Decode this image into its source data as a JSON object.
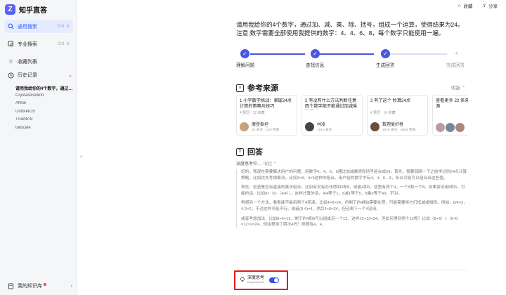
{
  "app": {
    "name": "知乎直答",
    "logo_glyph": "Z"
  },
  "sidebar": {
    "items": [
      {
        "label": "通用搜索",
        "shortcut_a": "Ctrl",
        "shortcut_b": "K",
        "icon": "search-icon"
      },
      {
        "label": "专业搜索",
        "shortcut_a": "Ctrl",
        "shortcut_b": "K",
        "icon": "expert-search-icon"
      },
      {
        "label": "收藏列表",
        "icon": "star-icon"
      }
    ],
    "history_label": "历史记录",
    "history": [
      "请用我给你的4个数字，通过加、减、乘、除、括号，组成一个运算，使得结果为24。",
      "CrystalDiskInfo",
      "Affine",
      "UmbrelOS",
      "TrueNAS",
      "tailscale"
    ],
    "knowledge_base": "我的知识库"
  },
  "top_actions": {
    "favorite": "收藏",
    "share": "分享"
  },
  "question": "请用我给你的4个数字，通过加、减、乘、除、括号，组成一个运算，使得结果为24。注意:数字需要全部使用我提供的数字：4、4、6、8，每个数字只能使用一遍。",
  "steps": [
    {
      "label": "理解问题",
      "done": true,
      "marker": "✓"
    },
    {
      "label": "查找信息",
      "done": true,
      "marker": "✓"
    },
    {
      "label": "生成回答",
      "done": true,
      "marker": "✓"
    },
    {
      "label": "完成回答",
      "done": false,
      "marker": "4"
    }
  ],
  "sources": {
    "title": "参考来源",
    "collapse": "收起",
    "cards": [
      {
        "index": "1",
        "title": "小学数学挑战：掌握24点计算的策略与技巧",
        "meta": "4 赞同 · 12 收藏",
        "author": "摩登泰坦",
        "stats": "24 关注 · 128 赞同"
      },
      {
        "index": "2",
        "title": "有没有什么方法判断任意四个数字能不能通过加减乘除得到24？",
        "meta": "",
        "author": "林凌",
        "stats": "1010 关注"
      },
      {
        "index": "3",
        "title": "有了这个 秒算24点",
        "meta": "4 赞同 · 14 收藏",
        "author": "数理爱好者",
        "stats": "1675 关注 · 3563 赞同"
      },
      {
        "index": "",
        "title": "查看更多 22 条来源",
        "meta": "",
        "author": "",
        "stats": ""
      }
    ]
  },
  "answer": {
    "title": "回答",
    "thinking_label": "深度思考中...",
    "thinking_collapse": "收起",
    "paragraphs": [
      "好的，我现在需要解决用户的问题，用数字4、4、6、8通过加减乘除和括号组合成24。首先，我要回顾一下之前学过的24点计算策略，比如优先考虑乘法，比如3×8、4×6这样的组合。用户给的数字中有4、4、6、8，所以可能可以组合出这些值。",
      "首先，检查是否有直接的乘法组合。比如有没有办法得到3和8，或者4和6。这里有两个4，一个6和一个8。如果尝试用8和6，可能的话，比如8×（6-（4/4））。这样计算的话，4/4等于1，6减1等于5，8乘5等于40，不对。",
      "再想另一个方法，看看能不能用两个4来凑。比如4×6=24，但剩下的4和8需要处理，可能需要将它们抵减或相除。例如，8/4=2，4-2=2，不过这样可能不行。或者(8-4)=4，然后4×6=24，但还剩下一个4没用。",
      "或者考虑加法，比如8+4=12，剩下的4和6可以组成另一个12，这样12+12=24。但如何得到两个12呢？比如（8+4）×（6-4）=12×2=24，但这里用了两次4吗？原题有4、4、"
    ]
  },
  "input": {
    "deep_think_label": "深度思考",
    "deep_think_sub": "DeepSeek-R1",
    "deep_think_on": true
  },
  "colors": {
    "accent": "#4a56e2",
    "highlight_box": "#e41b1b"
  }
}
